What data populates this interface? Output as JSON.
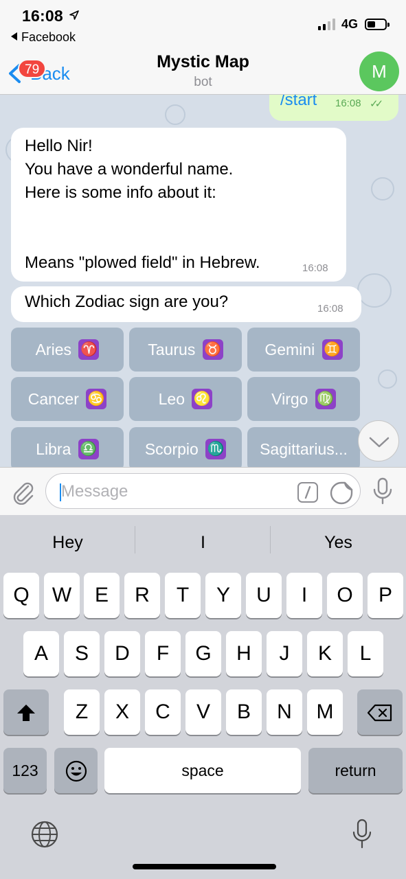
{
  "status_bar": {
    "time": "16:08",
    "back_app": "Facebook",
    "network": "4G",
    "signal_bars_active": 2,
    "signal_bars_total": 4,
    "battery_level": 0.45
  },
  "nav": {
    "back_label": "Back",
    "unread_badge": "79",
    "title": "Mystic Map",
    "subtitle": "bot",
    "avatar_initial": "M",
    "avatar_color": "#5bc75e",
    "accent_color": "#1a8cf0"
  },
  "chat": {
    "outgoing": {
      "text": "/start",
      "time": "16:08",
      "status_icon": "double-check-icon"
    },
    "messages": [
      {
        "lines": [
          "Hello Nir!",
          "You have a wonderful name.",
          "Here is some info about it:",
          "Means \"plowed field\" in Hebrew."
        ],
        "time": "16:08"
      },
      {
        "lines": [
          "Which Zodiac sign are you?"
        ],
        "time": "16:08"
      }
    ],
    "keyboard_buttons": [
      {
        "label": "Aries",
        "emoji": "♈"
      },
      {
        "label": "Taurus",
        "emoji": "♉"
      },
      {
        "label": "Gemini",
        "emoji": "♊"
      },
      {
        "label": "Cancer",
        "emoji": "♋"
      },
      {
        "label": "Leo",
        "emoji": "♌"
      },
      {
        "label": "Virgo",
        "emoji": "♍"
      },
      {
        "label": "Libra",
        "emoji": "♎"
      },
      {
        "label": "Scorpio",
        "emoji": "♏"
      },
      {
        "label": "Sagittarius...",
        "emoji": ""
      }
    ]
  },
  "input": {
    "value": "",
    "placeholder": "Message"
  },
  "keyboard": {
    "suggestions": [
      "Hey",
      "I",
      "Yes"
    ],
    "row1": [
      "Q",
      "W",
      "E",
      "R",
      "T",
      "Y",
      "U",
      "I",
      "O",
      "P"
    ],
    "row2": [
      "A",
      "S",
      "D",
      "F",
      "G",
      "H",
      "J",
      "K",
      "L"
    ],
    "row3": [
      "Z",
      "X",
      "C",
      "V",
      "B",
      "N",
      "M"
    ],
    "numbers_label": "123",
    "space_label": "space",
    "return_label": "return"
  }
}
